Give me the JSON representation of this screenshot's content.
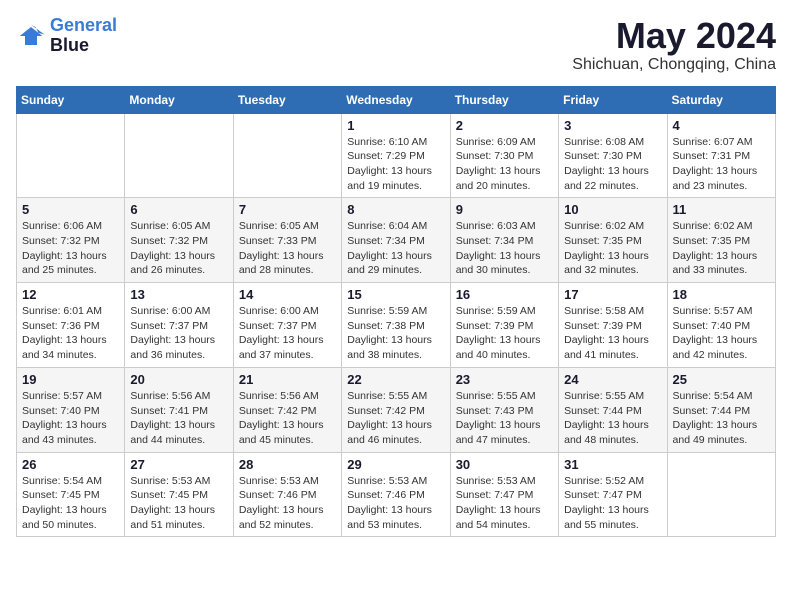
{
  "logo": {
    "line1": "General",
    "line2": "Blue"
  },
  "title": "May 2024",
  "location": "Shichuan, Chongqing, China",
  "weekdays": [
    "Sunday",
    "Monday",
    "Tuesday",
    "Wednesday",
    "Thursday",
    "Friday",
    "Saturday"
  ],
  "weeks": [
    [
      {
        "day": null,
        "data": null
      },
      {
        "day": null,
        "data": null
      },
      {
        "day": null,
        "data": null
      },
      {
        "day": "1",
        "data": "Sunrise: 6:10 AM\nSunset: 7:29 PM\nDaylight: 13 hours\nand 19 minutes."
      },
      {
        "day": "2",
        "data": "Sunrise: 6:09 AM\nSunset: 7:30 PM\nDaylight: 13 hours\nand 20 minutes."
      },
      {
        "day": "3",
        "data": "Sunrise: 6:08 AM\nSunset: 7:30 PM\nDaylight: 13 hours\nand 22 minutes."
      },
      {
        "day": "4",
        "data": "Sunrise: 6:07 AM\nSunset: 7:31 PM\nDaylight: 13 hours\nand 23 minutes."
      }
    ],
    [
      {
        "day": "5",
        "data": "Sunrise: 6:06 AM\nSunset: 7:32 PM\nDaylight: 13 hours\nand 25 minutes."
      },
      {
        "day": "6",
        "data": "Sunrise: 6:05 AM\nSunset: 7:32 PM\nDaylight: 13 hours\nand 26 minutes."
      },
      {
        "day": "7",
        "data": "Sunrise: 6:05 AM\nSunset: 7:33 PM\nDaylight: 13 hours\nand 28 minutes."
      },
      {
        "day": "8",
        "data": "Sunrise: 6:04 AM\nSunset: 7:34 PM\nDaylight: 13 hours\nand 29 minutes."
      },
      {
        "day": "9",
        "data": "Sunrise: 6:03 AM\nSunset: 7:34 PM\nDaylight: 13 hours\nand 30 minutes."
      },
      {
        "day": "10",
        "data": "Sunrise: 6:02 AM\nSunset: 7:35 PM\nDaylight: 13 hours\nand 32 minutes."
      },
      {
        "day": "11",
        "data": "Sunrise: 6:02 AM\nSunset: 7:35 PM\nDaylight: 13 hours\nand 33 minutes."
      }
    ],
    [
      {
        "day": "12",
        "data": "Sunrise: 6:01 AM\nSunset: 7:36 PM\nDaylight: 13 hours\nand 34 minutes."
      },
      {
        "day": "13",
        "data": "Sunrise: 6:00 AM\nSunset: 7:37 PM\nDaylight: 13 hours\nand 36 minutes."
      },
      {
        "day": "14",
        "data": "Sunrise: 6:00 AM\nSunset: 7:37 PM\nDaylight: 13 hours\nand 37 minutes."
      },
      {
        "day": "15",
        "data": "Sunrise: 5:59 AM\nSunset: 7:38 PM\nDaylight: 13 hours\nand 38 minutes."
      },
      {
        "day": "16",
        "data": "Sunrise: 5:59 AM\nSunset: 7:39 PM\nDaylight: 13 hours\nand 40 minutes."
      },
      {
        "day": "17",
        "data": "Sunrise: 5:58 AM\nSunset: 7:39 PM\nDaylight: 13 hours\nand 41 minutes."
      },
      {
        "day": "18",
        "data": "Sunrise: 5:57 AM\nSunset: 7:40 PM\nDaylight: 13 hours\nand 42 minutes."
      }
    ],
    [
      {
        "day": "19",
        "data": "Sunrise: 5:57 AM\nSunset: 7:40 PM\nDaylight: 13 hours\nand 43 minutes."
      },
      {
        "day": "20",
        "data": "Sunrise: 5:56 AM\nSunset: 7:41 PM\nDaylight: 13 hours\nand 44 minutes."
      },
      {
        "day": "21",
        "data": "Sunrise: 5:56 AM\nSunset: 7:42 PM\nDaylight: 13 hours\nand 45 minutes."
      },
      {
        "day": "22",
        "data": "Sunrise: 5:55 AM\nSunset: 7:42 PM\nDaylight: 13 hours\nand 46 minutes."
      },
      {
        "day": "23",
        "data": "Sunrise: 5:55 AM\nSunset: 7:43 PM\nDaylight: 13 hours\nand 47 minutes."
      },
      {
        "day": "24",
        "data": "Sunrise: 5:55 AM\nSunset: 7:44 PM\nDaylight: 13 hours\nand 48 minutes."
      },
      {
        "day": "25",
        "data": "Sunrise: 5:54 AM\nSunset: 7:44 PM\nDaylight: 13 hours\nand 49 minutes."
      }
    ],
    [
      {
        "day": "26",
        "data": "Sunrise: 5:54 AM\nSunset: 7:45 PM\nDaylight: 13 hours\nand 50 minutes."
      },
      {
        "day": "27",
        "data": "Sunrise: 5:53 AM\nSunset: 7:45 PM\nDaylight: 13 hours\nand 51 minutes."
      },
      {
        "day": "28",
        "data": "Sunrise: 5:53 AM\nSunset: 7:46 PM\nDaylight: 13 hours\nand 52 minutes."
      },
      {
        "day": "29",
        "data": "Sunrise: 5:53 AM\nSunset: 7:46 PM\nDaylight: 13 hours\nand 53 minutes."
      },
      {
        "day": "30",
        "data": "Sunrise: 5:53 AM\nSunset: 7:47 PM\nDaylight: 13 hours\nand 54 minutes."
      },
      {
        "day": "31",
        "data": "Sunrise: 5:52 AM\nSunset: 7:47 PM\nDaylight: 13 hours\nand 55 minutes."
      },
      {
        "day": null,
        "data": null
      }
    ]
  ]
}
